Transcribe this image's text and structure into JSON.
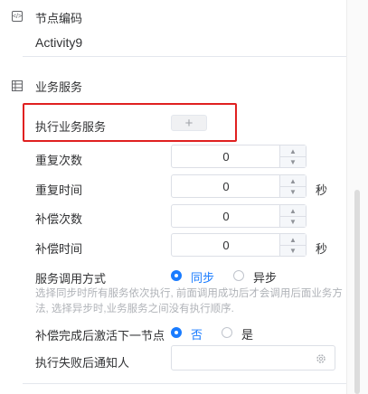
{
  "node_code": {
    "label": "节点编码",
    "value": "Activity9",
    "icon": "code-icon"
  },
  "business_service": {
    "section_title": "业务服务",
    "icon": "list-icon",
    "execute_label": "执行业务服务",
    "add_button": "+",
    "retry_count": {
      "label": "重复次数",
      "value": "0"
    },
    "retry_time": {
      "label": "重复时间",
      "value": "0",
      "unit": "秒"
    },
    "compensate_count": {
      "label": "补偿次数",
      "value": "0"
    },
    "compensate_time": {
      "label": "补偿时间",
      "value": "0",
      "unit": "秒"
    },
    "call_mode": {
      "label": "服务调用方式",
      "options": [
        "同步",
        "异步"
      ],
      "selected": "同步",
      "hint": "选择同步时所有服务依次执行, 前面调用成功后才会调用后面业务方法, 选择异步时,业务服务之间没有执行顺序."
    },
    "activate_next": {
      "label": "补偿完成后激活下一节点",
      "options": [
        "否",
        "是"
      ],
      "selected": "否"
    },
    "notify_on_fail": {
      "label": "执行失败后通知人",
      "value": "",
      "icon": "gear-icon"
    }
  },
  "colors": {
    "accent": "#1a7cff",
    "highlight": "#e02020"
  }
}
